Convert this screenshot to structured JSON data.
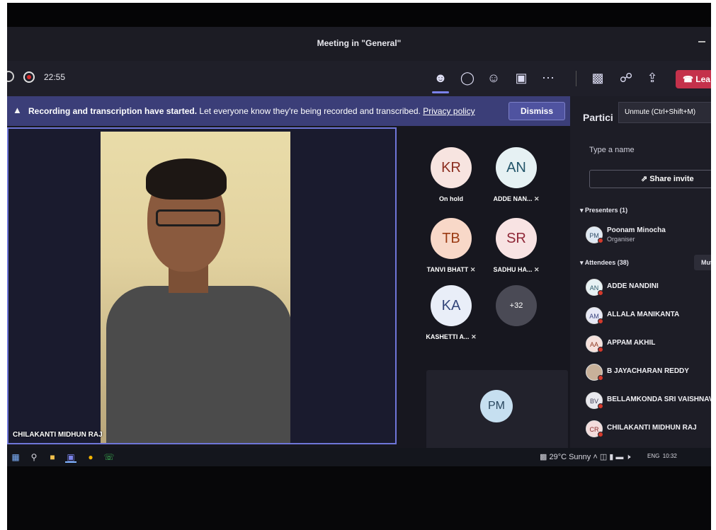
{
  "window": {
    "title": "Meeting in \"General\""
  },
  "toolbar": {
    "timer": "22:55",
    "icons": [
      "people-icon",
      "chat-icon",
      "reactions-icon",
      "rooms-icon",
      "more-icon",
      "camera-off-icon",
      "mic-off-icon",
      "share-icon"
    ],
    "leave_label": "Lea"
  },
  "banner": {
    "bold_text": "Recording and transcription have started.",
    "text": " Let everyone know they're being recorded and transcribed. ",
    "link": "Privacy policy",
    "dismiss": "Dismiss"
  },
  "main_video": {
    "name": "CHILAKANTI MIDHUN RAJ"
  },
  "tiles": [
    {
      "initials": "KR",
      "label": "On hold",
      "muted": false,
      "bg": "#f7e4e0",
      "fg": "#8b2d1f"
    },
    {
      "initials": "AN",
      "label": "ADDE NAN...",
      "muted": true,
      "bg": "#e6f1f3",
      "fg": "#24566a"
    },
    {
      "initials": "TB",
      "label": "TANVI BHATT",
      "muted": true,
      "bg": "#f8d8c8",
      "fg": "#9a3a12"
    },
    {
      "initials": "SR",
      "label": "SADHU HA...",
      "muted": true,
      "bg": "#f8e3e3",
      "fg": "#8f2838"
    },
    {
      "initials": "KA",
      "label": "KASHETTI A...",
      "muted": true,
      "bg": "#e9eef8",
      "fg": "#34467a"
    },
    {
      "initials": "+32",
      "label": "",
      "muted": false,
      "bg": "#4a4a55",
      "fg": "#ffffff"
    }
  ],
  "pm_tile": {
    "initials": "PM"
  },
  "panel": {
    "title": "Partici",
    "tooltip": "Unmute (Ctrl+Shift+M)",
    "search_placeholder": "Type a name",
    "share_label": "Share invite",
    "presenters_heading": "Presenters (1)",
    "presenters": [
      {
        "initials": "PM",
        "name": "Poonam Minocha",
        "role": "Organiser"
      }
    ],
    "attendees_heading": "Attendees (38)",
    "mute_all": "Mute",
    "attendees": [
      {
        "initials": "AN",
        "name": "ADDE NANDINI",
        "bg": "#e7f2f4",
        "fg": "#2c5a6a"
      },
      {
        "initials": "AM",
        "name": "ALLALA MANIKANTA",
        "bg": "#e7e9f6",
        "fg": "#3a4580"
      },
      {
        "initials": "AA",
        "name": "APPAM AKHIL",
        "bg": "#f6e1dc",
        "fg": "#8f3a22"
      },
      {
        "initials": "",
        "name": "B JAYACHARAN REDDY",
        "bg": "#c8b19a",
        "fg": "#3d2a1a"
      },
      {
        "initials": "BV",
        "name": "BELLAMKONDA SRI VAISHNAVI",
        "bg": "#e8e8ee",
        "fg": "#44445a"
      },
      {
        "initials": "CR",
        "name": "CHILAKANTI MIDHUN RAJ",
        "bg": "#f3dcdc",
        "fg": "#8a2c2c"
      }
    ]
  },
  "taskbar": {
    "weather": "29°C  Sunny",
    "lang": "ENG",
    "time": "10:32"
  }
}
